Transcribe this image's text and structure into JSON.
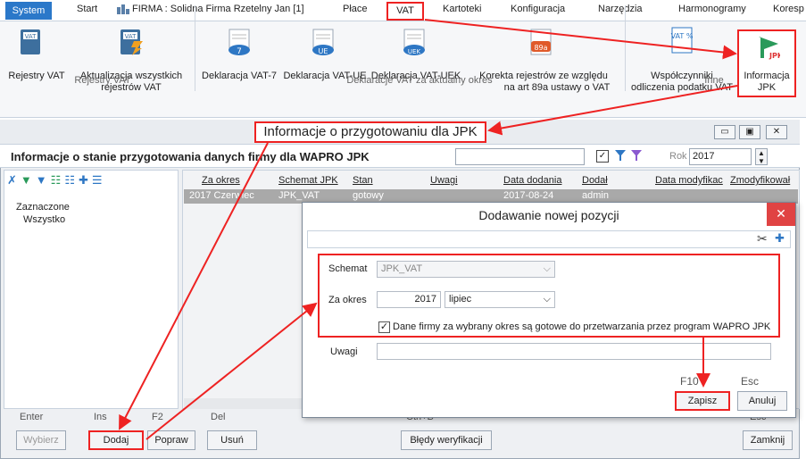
{
  "menubar": {
    "items": [
      "System",
      "Start",
      "FIRMA : Solidna Firma Rzetelny Jan [1]",
      "Płace",
      "VAT",
      "Kartoteki",
      "Konfiguracja",
      "Narzędzia",
      "Harmonogramy",
      "Koresp"
    ]
  },
  "ribbon": {
    "buttons": {
      "rejestry_vat": "Rejestry VAT",
      "aktualizacja_1": "Aktualizacja wszystkich",
      "aktualizacja_2": "rejestrów VAT",
      "dekl_vat7": "Deklaracja VAT-7",
      "dekl_vatue": "Deklaracja VAT-UE",
      "dekl_vatuek": "Deklaracja VAT-UEK",
      "korekta_1": "Korekta rejestrów ze względu",
      "korekta_2": "na art 89a ustawy o VAT",
      "wspolczynniki_1": "Współczynniki",
      "wspolczynniki_2": "odliczenia podatku VAT",
      "informacja_1": "Informacja",
      "informacja_2": "JPK"
    },
    "icon_labels": {
      "vat7": "7",
      "ue": "UE",
      "uek": "UEK",
      "a89": "89a",
      "vatpct": "VAT %",
      "jpk": "JPK"
    },
    "groups": {
      "rejestry": "Rejestry VAT",
      "deklaracje": "Deklaracje VAT za aktualny okres",
      "inne": "Inne"
    }
  },
  "window": {
    "title": "Informacje o przygotowaniu dla JPK",
    "header": "Informacje o stanie przygotowania danych firmy dla WAPRO JPK",
    "rok_label": "Rok",
    "rok_value": "2017"
  },
  "leftpanel": {
    "items": [
      "Zaznaczone",
      "Wszystko"
    ]
  },
  "grid": {
    "columns": [
      "Za okres",
      "Schemat JPK",
      "Stan",
      "Uwagi",
      "Data dodania",
      "Dodał",
      "Data modyfikac",
      "Zmodyfikował"
    ],
    "row": [
      "2017 Czerwiec",
      "JPK_VAT",
      "gotowy",
      "",
      "2017-08-24",
      "admin",
      "",
      ""
    ]
  },
  "bottom": {
    "keys": {
      "enter": "Enter",
      "ins": "Ins",
      "f2": "F2",
      "del": "Del",
      "ctrlb": "Ctrl+B",
      "esc": "Esc"
    },
    "buttons": {
      "wybierz": "Wybierz",
      "dodaj": "Dodaj",
      "popraw": "Popraw",
      "usun": "Usuń",
      "bledy": "Błędy weryfikacji",
      "zamknij": "Zamknij"
    }
  },
  "dialog": {
    "title": "Dodawanie nowej pozycji",
    "schemat_label": "Schemat",
    "schemat_value": "JPK_VAT",
    "zaokres_label": "Za okres",
    "year": "2017",
    "month": "lipiec",
    "checkbox_label": "Dane firmy za wybrany okres są gotowe do przetwarzania przez program WAPRO JPK",
    "checkbox_checked": true,
    "uwagi_label": "Uwagi",
    "uwagi_value": "",
    "f10": "F10",
    "esc": "Esc",
    "zapisz": "Zapisz",
    "anuluj": "Anuluj"
  },
  "colors": {
    "accent": "#2b78c9",
    "highlight": "#e22222"
  }
}
